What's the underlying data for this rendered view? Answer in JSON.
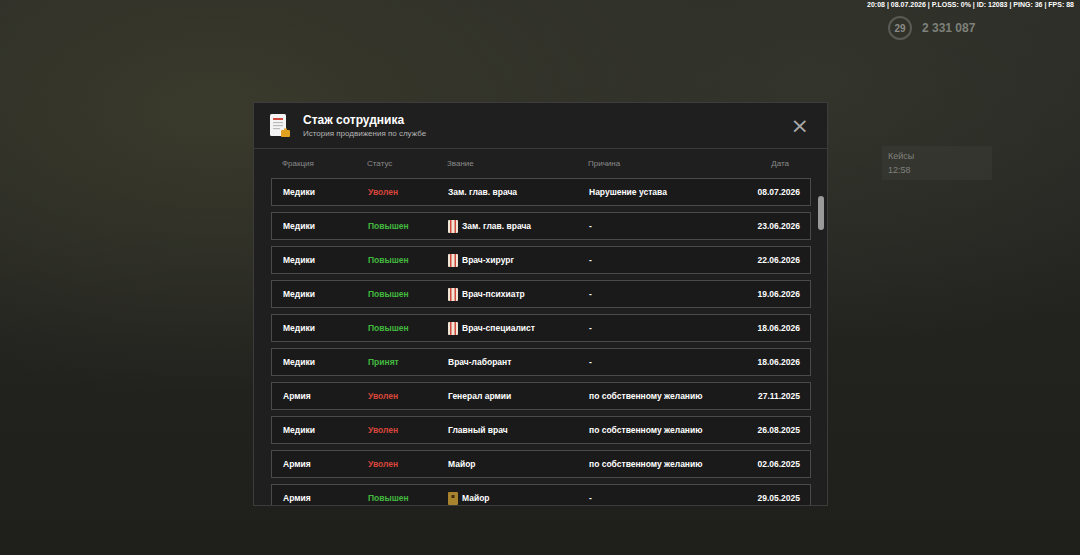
{
  "hud": {
    "status": "20:08 | 08.07.2026 | P.LOSS: 0% | ID: 12083 | PING: 36 | FPS: 88",
    "level": "29",
    "money": "2 331 087",
    "cases_title": "Кейсы",
    "cases_timer": "12:58"
  },
  "window": {
    "title": "Стаж сотрудника",
    "subtitle": "История продвижения по службе",
    "close": "×"
  },
  "table": {
    "columns": [
      "Фракция",
      "Статус",
      "Звание",
      "Причина",
      "Дата"
    ],
    "rows": [
      {
        "faction": "Медики",
        "status": "Уволен",
        "color": "#d9453b",
        "rank": "Зам. глав. врача",
        "badge": "none",
        "reason": "Нарушение устава",
        "date": "08.07.2026"
      },
      {
        "faction": "Медики",
        "status": "Повышен",
        "color": "#43b83f",
        "rank": "Зам. глав. врача",
        "badge": "medic",
        "reason": "-",
        "date": "23.06.2026"
      },
      {
        "faction": "Медики",
        "status": "Повышен",
        "color": "#43b83f",
        "rank": "Врач-хирург",
        "badge": "medic",
        "reason": "-",
        "date": "22.06.2026"
      },
      {
        "faction": "Медики",
        "status": "Повышен",
        "color": "#43b83f",
        "rank": "Врач-психиатр",
        "badge": "medic",
        "reason": "-",
        "date": "19.06.2026"
      },
      {
        "faction": "Медики",
        "status": "Повышен",
        "color": "#43b83f",
        "rank": "Врач-специалист",
        "badge": "medic",
        "reason": "-",
        "date": "18.06.2026"
      },
      {
        "faction": "Медики",
        "status": "Принят",
        "color": "#43b83f",
        "rank": "Врач-лаборант",
        "badge": "none",
        "reason": "-",
        "date": "18.06.2026"
      },
      {
        "faction": "Армия",
        "status": "Уволен",
        "color": "#d9453b",
        "rank": "Генерал армии",
        "badge": "none",
        "reason": "по собственному желанию",
        "date": "27.11.2025"
      },
      {
        "faction": "Медики",
        "status": "Уволен",
        "color": "#d9453b",
        "rank": "Главный врач",
        "badge": "none",
        "reason": "по собственному желанию",
        "date": "26.08.2025"
      },
      {
        "faction": "Армия",
        "status": "Уволен",
        "color": "#d9453b",
        "rank": "Майор",
        "badge": "none",
        "reason": "по собственному желанию",
        "date": "02.06.2025"
      },
      {
        "faction": "Армия",
        "status": "Повышен",
        "color": "#43b83f",
        "rank": "Майор",
        "badge": "army",
        "reason": "-",
        "date": "29.05.2025"
      }
    ]
  },
  "scrollbar": {
    "level": 0.03
  }
}
